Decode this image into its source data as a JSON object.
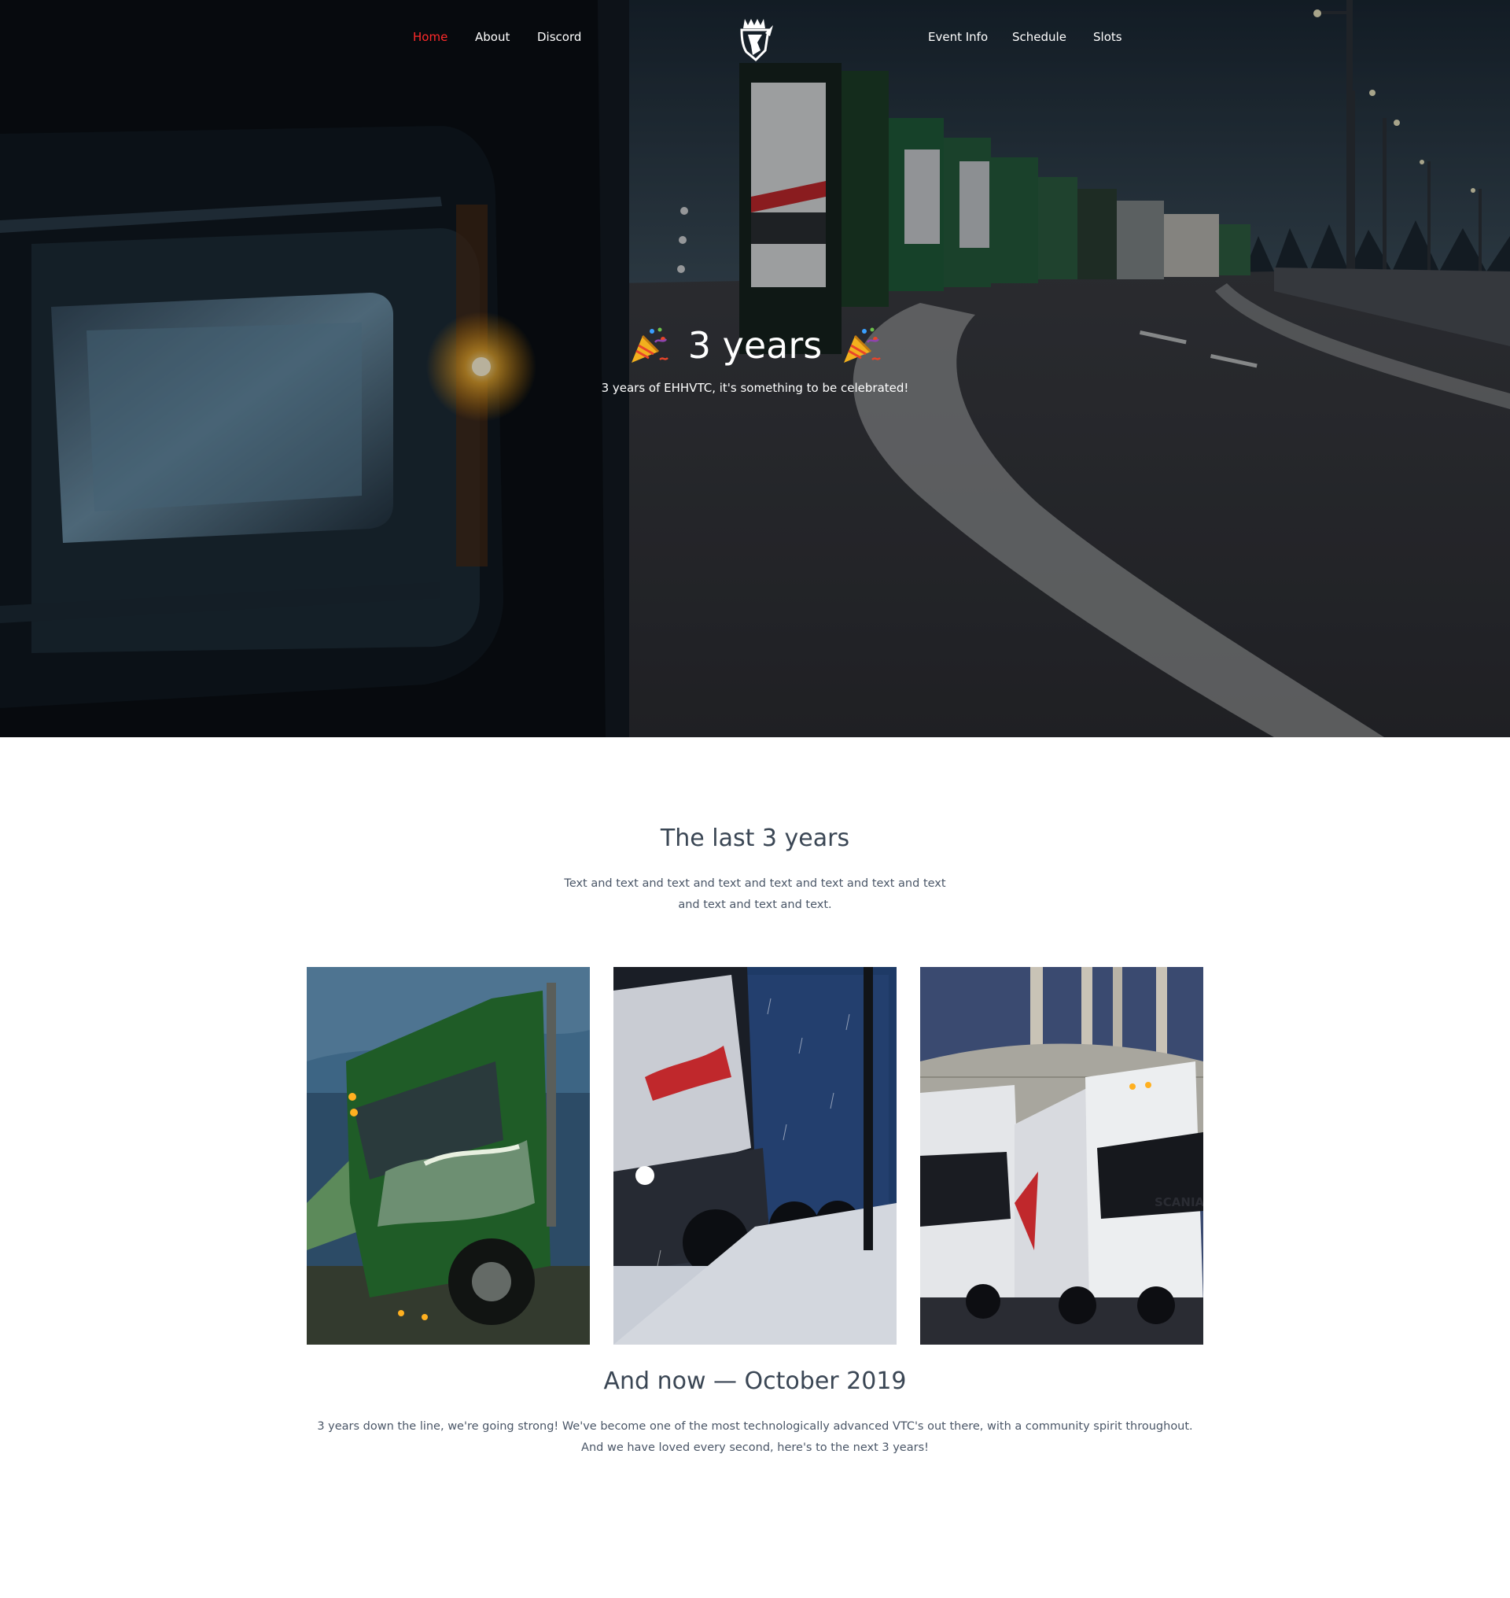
{
  "nav": {
    "left": [
      {
        "label": "Home",
        "active": true
      },
      {
        "label": "About",
        "active": false
      },
      {
        "label": "Discord",
        "active": false
      }
    ],
    "right": [
      {
        "label": "Event Info"
      },
      {
        "label": "Schedule"
      },
      {
        "label": "Slots"
      }
    ],
    "logo_icon": "lion-crest-logo",
    "active_color": "#ff2a2a"
  },
  "hero": {
    "title": "3 years",
    "title_icon": "party-popper-icon",
    "subtitle": "3 years of EHHVTC, it's something to be celebrated!"
  },
  "history": {
    "title": "The last 3 years",
    "text_line1": "Text and text and text and text and text and text and text and text",
    "text_line2": "and text and text and text."
  },
  "gallery": {
    "photos": [
      "green-truck-photo",
      "snow-truck-photo",
      "scania-convoy-photo"
    ],
    "truck_label": "SCANIA"
  },
  "now": {
    "title": "And now — October 2019",
    "text_line1": "3 years down the line, we're going strong! We've become one of the most technologically advanced VTC's out there, with a community spirit throughout.",
    "text_line2": "And we have loved every second, here's to the next 3 years!"
  }
}
